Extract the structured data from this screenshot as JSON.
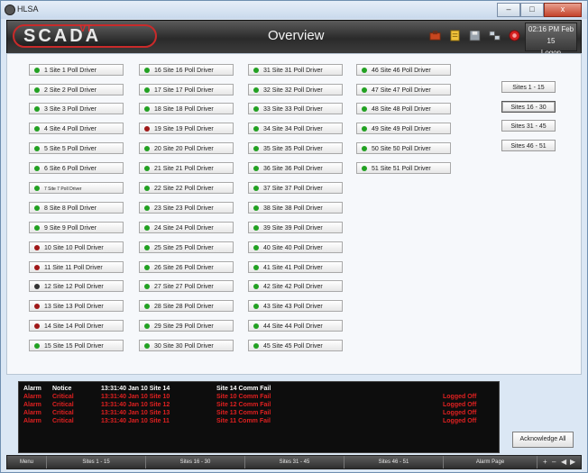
{
  "window": {
    "title": "HLSA",
    "controls": [
      "–",
      "□",
      "x"
    ]
  },
  "header": {
    "logo": "SCADA",
    "logo_overlay": "VT",
    "title": "Overview",
    "clock_time": "02:16 PM Feb 15",
    "logon": "Logon"
  },
  "toolbar_icons": [
    "briefcase-icon",
    "notes-icon",
    "save-icon",
    "network-icon",
    "alarm-bell-icon"
  ],
  "sites": [
    {
      "label": "1 Site 1 Poll Driver",
      "status": "green"
    },
    {
      "label": "2 Site 2 Poll Driver",
      "status": "green"
    },
    {
      "label": "3 Site 3 Poll Driver",
      "status": "green"
    },
    {
      "label": "4 Site 4 Poll Driver",
      "status": "green"
    },
    {
      "label": "5 Site 5 Poll Driver",
      "status": "green"
    },
    {
      "label": "6 Site 6 Poll Driver",
      "status": "green"
    },
    {
      "label": "7 Site 7 Poll Driver",
      "status": "green"
    },
    {
      "label": "8 Site 8 Poll Driver",
      "status": "green"
    },
    {
      "label": "9 Site 9 Poll Driver",
      "status": "green"
    },
    {
      "label": "10 Site 10 Poll Driver",
      "status": "red"
    },
    {
      "label": "11 Site 11 Poll Driver",
      "status": "red"
    },
    {
      "label": "12 Site 12 Poll Driver",
      "status": "gray"
    },
    {
      "label": "13 Site 13 Poll Driver",
      "status": "red"
    },
    {
      "label": "14 Site 14 Poll Driver",
      "status": "red"
    },
    {
      "label": "15 Site 15 Poll Driver",
      "status": "green"
    },
    {
      "label": "16 Site 16 Poll Driver",
      "status": "green"
    },
    {
      "label": "17 Site 17 Poll Driver",
      "status": "green"
    },
    {
      "label": "18 Site 18 Poll Driver",
      "status": "green"
    },
    {
      "label": "19 Site 19 Poll Driver",
      "status": "red"
    },
    {
      "label": "20 Site 20 Poll Driver",
      "status": "green"
    },
    {
      "label": "21 Site 21 Poll Driver",
      "status": "green"
    },
    {
      "label": "22 Site 22 Poll Driver",
      "status": "green"
    },
    {
      "label": "23 Site 23 Poll Driver",
      "status": "green"
    },
    {
      "label": "24 Site 24 Poll Driver",
      "status": "green"
    },
    {
      "label": "25 Site 25 Poll Driver",
      "status": "green"
    },
    {
      "label": "26 Site 26 Poll Driver",
      "status": "green"
    },
    {
      "label": "27 Site 27 Poll Driver",
      "status": "green"
    },
    {
      "label": "28 Site 28 Poll Driver",
      "status": "green"
    },
    {
      "label": "29 Site 29 Poll Driver",
      "status": "green"
    },
    {
      "label": "30 Site 30 Poll Driver",
      "status": "green"
    },
    {
      "label": "31 Site 31 Poll Driver",
      "status": "green"
    },
    {
      "label": "32 Site 32 Poll Driver",
      "status": "green"
    },
    {
      "label": "33 Site 33 Poll Driver",
      "status": "green"
    },
    {
      "label": "34 Site 34 Poll Driver",
      "status": "green"
    },
    {
      "label": "35 Site 35 Poll Driver",
      "status": "green"
    },
    {
      "label": "36 Site 36 Poll Driver",
      "status": "green"
    },
    {
      "label": "37 Site 37 Poll Driver",
      "status": "green"
    },
    {
      "label": "38 Site 38 Poll Driver",
      "status": "green"
    },
    {
      "label": "39 Site 39 Poll Driver",
      "status": "green"
    },
    {
      "label": "40 Site 40 Poll Driver",
      "status": "green"
    },
    {
      "label": "41 Site 41 Poll Driver",
      "status": "green"
    },
    {
      "label": "42 Site 42 Poll Driver",
      "status": "green"
    },
    {
      "label": "43 Site 43 Poll Driver",
      "status": "green"
    },
    {
      "label": "44 Site 44 Poll Driver",
      "status": "green"
    },
    {
      "label": "45 Site 45 Poll Driver",
      "status": "green"
    },
    {
      "label": "46 Site 46 Poll Driver",
      "status": "green"
    },
    {
      "label": "47 Site 47 Poll Driver",
      "status": "green"
    },
    {
      "label": "48 Site 48 Poll Driver",
      "status": "green"
    },
    {
      "label": "49 Site 49 Poll Driver",
      "status": "green"
    },
    {
      "label": "50 Site 50 Poll Driver",
      "status": "green"
    },
    {
      "label": "51 Site 51 Poll Driver",
      "status": "green"
    }
  ],
  "nav": {
    "items": [
      "Sites 1 - 15",
      "Sites 16 - 30",
      "Sites 31 - 45",
      "Sites 46 - 51"
    ],
    "active": "Sites 16 - 30"
  },
  "alarm_summary": {
    "header": {
      "type": "Alarm",
      "severity": "Notice",
      "time_site": "13:31:40 Jan 10 Site 14",
      "message": "Site 14 Comm Fail",
      "state": ""
    },
    "rows": [
      {
        "type": "Alarm",
        "severity": "Critical",
        "time_site": "13:31:40 Jan 10 Site 10",
        "message": "Site 10 Comm Fail",
        "state": "Logged Off"
      },
      {
        "type": "Alarm",
        "severity": "Critical",
        "time_site": "13:31:40 Jan 10 Site 12",
        "message": "Site 12 Comm Fail",
        "state": "Logged Off"
      },
      {
        "type": "Alarm",
        "severity": "Critical",
        "time_site": "13:31:40 Jan 10 Site 13",
        "message": "Site 13 Comm Fail",
        "state": "Logged Off"
      },
      {
        "type": "Alarm",
        "severity": "Critical",
        "time_site": "13:31:40 Jan 10 Site 11",
        "message": "Site 11 Comm Fail",
        "state": "Logged Off"
      }
    ]
  },
  "acknowledge_label": "Acknowledge All",
  "bottom_bar": [
    "Menu",
    "Sites 1 - 15",
    "Sites 16 - 30",
    "Sites 31 - 45",
    "Sites 46 - 51",
    "Alarm Page"
  ],
  "bottom_controls": [
    "+",
    "–",
    "◀",
    "▶"
  ],
  "colors": {
    "status_green": "#22a122",
    "status_red": "#a01818",
    "status_gray": "#333333",
    "alarm_text": "#e02020",
    "alarm_header_text": "#ffffff"
  }
}
